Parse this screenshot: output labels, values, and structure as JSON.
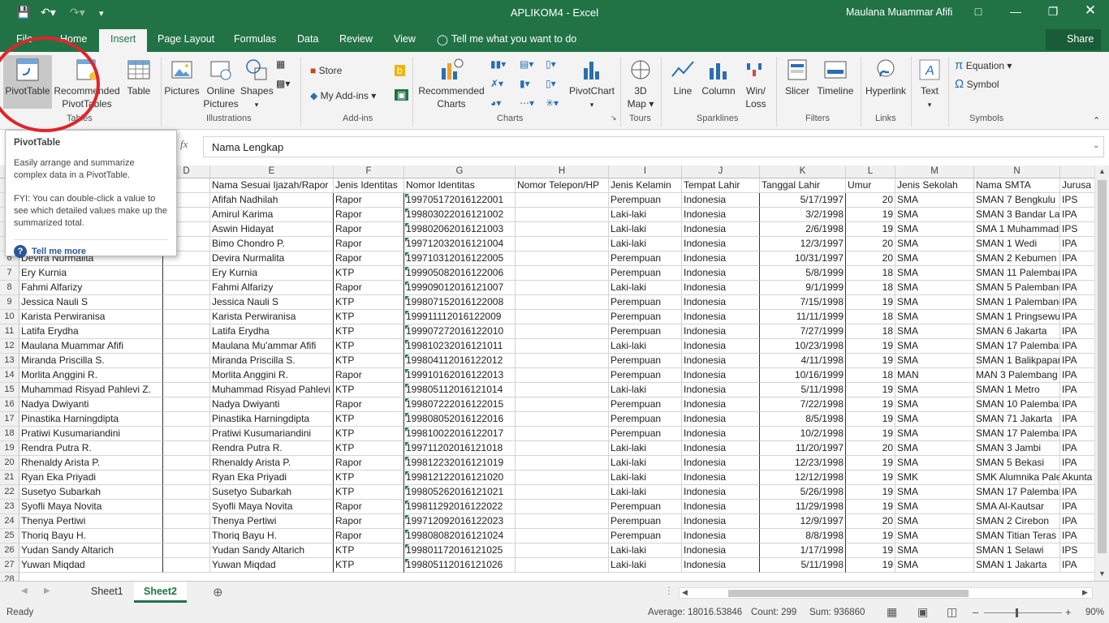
{
  "title": "APLIKOM4 - Excel",
  "user": "Maulana Muammar Afifi",
  "ribbon_tabs": [
    "File",
    "Home",
    "Insert",
    "Page Layout",
    "Formulas",
    "Data",
    "Review",
    "View"
  ],
  "tell_me": "Tell me what you want to do",
  "share": "Share",
  "ribbon": {
    "pivottable": "PivotTable",
    "recommended_pivot": [
      "Recommended",
      "PivotTables"
    ],
    "table": "Table",
    "pictures": "Pictures",
    "online_pictures": [
      "Online",
      "Pictures"
    ],
    "shapes": "Shapes",
    "store": "Store",
    "my_addins": "My Add-ins",
    "recommended_charts": [
      "Recommended",
      "Charts"
    ],
    "pivotchart": "PivotChart",
    "map3d": [
      "3D",
      "Map"
    ],
    "line": "Line",
    "column": "Column",
    "winloss": [
      "Win/",
      "Loss"
    ],
    "slicer": "Slicer",
    "timeline": "Timeline",
    "hyperlink": "Hyperlink",
    "text": "Text",
    "equation": "Equation",
    "symbol": "Symbol",
    "groups": [
      "Tables",
      "Illustrations",
      "Add-ins",
      "Charts",
      "Tours",
      "Sparklines",
      "Filters",
      "Links",
      "Symbols"
    ]
  },
  "formula": {
    "fx": "fx",
    "value": "Nama Lengkap"
  },
  "tooltip": {
    "title": "PivotTable",
    "body": "Easily arrange and summarize complex data in a PivotTable.",
    "fyi": "FYI: You can double-click a value to see which detailed values make up the summarized total.",
    "link": "Tell me more"
  },
  "column_headers": [
    "D",
    "E",
    "F",
    "G",
    "H",
    "I",
    "J",
    "K",
    "L",
    "M",
    "N"
  ],
  "header_row": [
    "Nama Sesuai Ijazah/Rapor",
    "Jenis Identitas",
    "Nomor Identitas",
    "Nomor Telepon/HP",
    "Jenis Kelamin",
    "Tempat Lahir",
    "Tanggal Lahir",
    "Umur",
    "Jenis Sekolah",
    "Nama SMTA",
    "Jurusa"
  ],
  "rows": [
    {
      "r": "2",
      "a": "",
      "e": "Afifah Nadhilah",
      "f": "Rapor",
      "g": "199705172016122001",
      "i": "Perempuan",
      "j": "Indonesia",
      "k": "5/17/1997",
      "l": "20",
      "m": "SMA",
      "n": "SMAN 7 Bengkulu",
      "o": "IPS"
    },
    {
      "r": "3",
      "a": "",
      "e": "Amirul Karima",
      "f": "Rapor",
      "g": "199803022016121002",
      "i": "Laki-laki",
      "j": "Indonesia",
      "k": "3/2/1998",
      "l": "19",
      "m": "SMA",
      "n": "SMAN 3 Bandar Lam",
      "o": "IPA"
    },
    {
      "r": "4",
      "a": "",
      "e": "Aswin Hidayat",
      "f": "Rapor",
      "g": "199802062016121003",
      "i": "Laki-laki",
      "j": "Indonesia",
      "k": "2/6/1998",
      "l": "19",
      "m": "SMA",
      "n": "SMA 1 Muhammadi",
      "o": "IPS"
    },
    {
      "r": "5",
      "a": "",
      "e": "Bimo Chondro P.",
      "f": "Rapor",
      "g": "199712032016121004",
      "i": "Laki-laki",
      "j": "Indonesia",
      "k": "12/3/1997",
      "l": "20",
      "m": "SMA",
      "n": "SMAN 1 Wedi",
      "o": "IPA"
    },
    {
      "r": "6",
      "a": "Devira Nurmalita",
      "e": "Devira Nurmalita",
      "f": "Rapor",
      "g": "199710312016122005",
      "i": "Perempuan",
      "j": "Indonesia",
      "k": "10/31/1997",
      "l": "20",
      "m": "SMA",
      "n": "SMAN 2 Kebumen",
      "o": "IPA"
    },
    {
      "r": "7",
      "a": "Ery Kurnia",
      "e": "Ery Kurnia",
      "f": "KTP",
      "g": "199905082016122006",
      "i": "Perempuan",
      "j": "Indonesia",
      "k": "5/8/1999",
      "l": "18",
      "m": "SMA",
      "n": "SMAN 11 Palembang",
      "o": "IPA"
    },
    {
      "r": "8",
      "a": "Fahmi Alfarizy",
      "e": "Fahmi Alfarizy",
      "f": "Rapor",
      "g": "199909012016121007",
      "i": "Laki-laki",
      "j": "Indonesia",
      "k": "9/1/1999",
      "l": "18",
      "m": "SMA",
      "n": "SMAN 5 Palembang",
      "o": "IPA"
    },
    {
      "r": "9",
      "a": "Jessica Nauli S",
      "e": "Jessica Nauli S",
      "f": "KTP",
      "g": "199807152016122008",
      "i": "Perempuan",
      "j": "Indonesia",
      "k": "7/15/1998",
      "l": "19",
      "m": "SMA",
      "n": "SMAN 1 Palembang",
      "o": "IPA"
    },
    {
      "r": "10",
      "a": "Karista Perwiranisa",
      "e": "Karista Perwiranisa",
      "f": "KTP",
      "g": "199911112016122009",
      "i": "Perempuan",
      "j": "Indonesia",
      "k": "11/11/1999",
      "l": "18",
      "m": "SMA",
      "n": "SMAN 1 Pringsewu",
      "o": "IPA"
    },
    {
      "r": "11",
      "a": "Latifa Erydha",
      "e": "Latifa Erydha",
      "f": "KTP",
      "g": "199907272016122010",
      "i": "Perempuan",
      "j": "Indonesia",
      "k": "7/27/1999",
      "l": "18",
      "m": "SMA",
      "n": "SMAN 6 Jakarta",
      "o": "IPA"
    },
    {
      "r": "12",
      "a": "Maulana Muammar Afifi",
      "e": "Maulana Mu'ammar Afifi",
      "f": "KTP",
      "g": "199810232016121011",
      "i": "Laki-laki",
      "j": "Indonesia",
      "k": "10/23/1998",
      "l": "19",
      "m": "SMA",
      "n": "SMAN 17 Palembang",
      "o": "IPA"
    },
    {
      "r": "13",
      "a": "Miranda Priscilla S.",
      "e": "Miranda Priscilla S.",
      "f": "KTP",
      "g": "199804112016122012",
      "i": "Perempuan",
      "j": "Indonesia",
      "k": "4/11/1998",
      "l": "19",
      "m": "SMA",
      "n": "SMAN 1 Balikpapan",
      "o": "IPA"
    },
    {
      "r": "14",
      "a": "Morlita Anggini R.",
      "e": "Morlita Anggini R.",
      "f": "Rapor",
      "g": "199910162016122013",
      "i": "Perempuan",
      "j": "Indonesia",
      "k": "10/16/1999",
      "l": "18",
      "m": "MAN",
      "n": "MAN 3 Palembang",
      "o": "IPA"
    },
    {
      "r": "15",
      "a": "Muhammad Risyad Pahlevi Z.",
      "e": "Muhammad Risyad Pahlevi",
      "f": "KTP",
      "g": "199805112016121014",
      "i": "Laki-laki",
      "j": "Indonesia",
      "k": "5/11/1998",
      "l": "19",
      "m": "SMA",
      "n": "SMAN 1 Metro",
      "o": "IPA"
    },
    {
      "r": "16",
      "a": "Nadya Dwiyanti",
      "e": "Nadya Dwiyanti",
      "f": "Rapor",
      "g": "199807222016122015",
      "i": "Perempuan",
      "j": "Indonesia",
      "k": "7/22/1998",
      "l": "19",
      "m": "SMA",
      "n": "SMAN 10 Palembang",
      "o": "IPA"
    },
    {
      "r": "17",
      "a": "Pinastika Harningdipta",
      "e": "Pinastika Harningdipta",
      "f": "KTP",
      "g": "199808052016122016",
      "i": "Perempuan",
      "j": "Indonesia",
      "k": "8/5/1998",
      "l": "19",
      "m": "SMA",
      "n": "SMAN 71 Jakarta",
      "o": "IPA"
    },
    {
      "r": "18",
      "a": "Pratiwi Kusumariandini",
      "e": "Pratiwi Kusumariandini",
      "f": "KTP",
      "g": "199810022016122017",
      "i": "Perempuan",
      "j": "Indonesia",
      "k": "10/2/1998",
      "l": "19",
      "m": "SMA",
      "n": "SMAN 17 Palembang",
      "o": "IPA"
    },
    {
      "r": "19",
      "a": "Rendra Putra R.",
      "e": "Rendra Putra R.",
      "f": "KTP",
      "g": "199711202016121018",
      "i": "Laki-laki",
      "j": "Indonesia",
      "k": "11/20/1997",
      "l": "20",
      "m": "SMA",
      "n": "SMAN 3 Jambi",
      "o": "IPA"
    },
    {
      "r": "20",
      "a": "Rhenaldy Arista P.",
      "e": "Rhenaldy Arista P.",
      "f": "Rapor",
      "g": "199812232016121019",
      "i": "Laki-laki",
      "j": "Indonesia",
      "k": "12/23/1998",
      "l": "19",
      "m": "SMA",
      "n": "SMAN 5 Bekasi",
      "o": "IPA"
    },
    {
      "r": "21",
      "a": "Ryan Eka Priyadi",
      "e": "Ryan Eka Priyadi",
      "f": "KTP",
      "g": "199812122016121020",
      "i": "Laki-laki",
      "j": "Indonesia",
      "k": "12/12/1998",
      "l": "19",
      "m": "SMK",
      "n": "SMK Alumnika Pale",
      "o": "Akunta"
    },
    {
      "r": "22",
      "a": "Susetyo Subarkah",
      "e": "Susetyo Subarkah",
      "f": "KTP",
      "g": "199805262016121021",
      "i": "Laki-laki",
      "j": "Indonesia",
      "k": "5/26/1998",
      "l": "19",
      "m": "SMA",
      "n": "SMAN 17 Palembang",
      "o": "IPA"
    },
    {
      "r": "23",
      "a": "Syofli Maya Novita",
      "e": "Syofli Maya Novita",
      "f": "Rapor",
      "g": "199811292016122022",
      "i": "Perempuan",
      "j": "Indonesia",
      "k": "11/29/1998",
      "l": "19",
      "m": "SMA",
      "n": "SMA Al-Kautsar",
      "o": "IPA"
    },
    {
      "r": "24",
      "a": "Thenya Pertiwi",
      "e": "Thenya Pertiwi",
      "f": "Rapor",
      "g": "199712092016122023",
      "i": "Perempuan",
      "j": "Indonesia",
      "k": "12/9/1997",
      "l": "20",
      "m": "SMA",
      "n": "SMAN 2 Cirebon",
      "o": "IPA"
    },
    {
      "r": "25",
      "a": "Thoriq Bayu H.",
      "e": "Thoriq Bayu H.",
      "f": "Rapor",
      "g": "199808082016121024",
      "i": "Perempuan",
      "j": "Indonesia",
      "k": "8/8/1998",
      "l": "19",
      "m": "SMA",
      "n": "SMAN Titian Teras",
      "o": "IPA"
    },
    {
      "r": "26",
      "a": "Yudan Sandy Altarich",
      "e": "Yudan Sandy Altarich",
      "f": "KTP",
      "g": "199801172016121025",
      "i": "Laki-laki",
      "j": "Indonesia",
      "k": "1/17/1998",
      "l": "19",
      "m": "SMA",
      "n": "SMAN 1 Selawi",
      "o": "IPS"
    },
    {
      "r": "27",
      "a": "Yuwan Miqdad",
      "e": "Yuwan Miqdad",
      "f": "KTP",
      "g": "199805112016121026",
      "i": "Laki-laki",
      "j": "Indonesia",
      "k": "5/11/1998",
      "l": "19",
      "m": "SMA",
      "n": "SMAN 1 Jakarta",
      "o": "IPA"
    }
  ],
  "last_row": "28",
  "sheets": [
    "Sheet1",
    "Sheet2"
  ],
  "status": {
    "ready": "Ready",
    "average": "Average: 18016.53846",
    "count": "Count: 299",
    "sum": "Sum: 936860",
    "zoom": "90%"
  }
}
